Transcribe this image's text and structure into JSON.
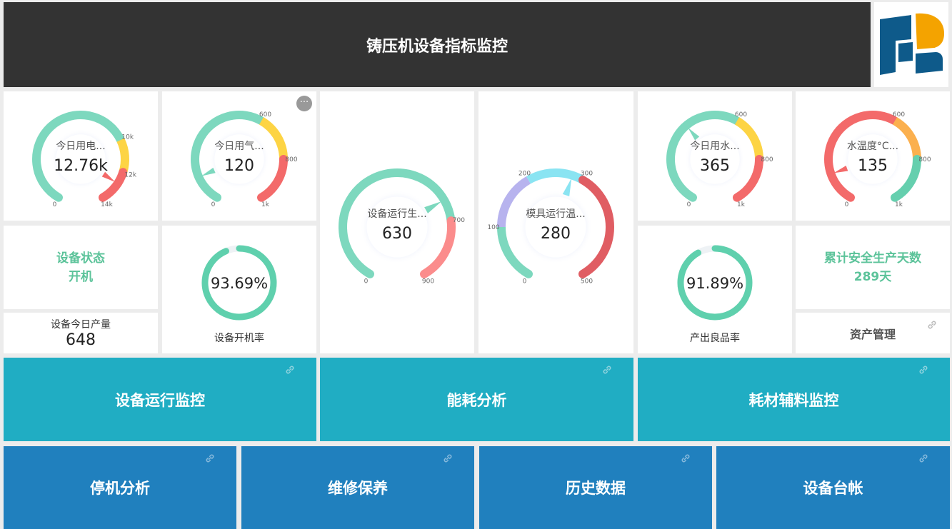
{
  "header": {
    "title": "铸压机设备指标监控"
  },
  "colors": {
    "green": "#7dd8be",
    "yellow": "#fdd444",
    "red": "#f36a6a",
    "teal": "#20adc3",
    "blue": "#2080be"
  },
  "gauges": [
    {
      "id": "electricity",
      "label": "今日用电...",
      "value": "12.76k",
      "num": 12760,
      "max": 14000,
      "ticks": [
        {
          "v": 0,
          "t": "0"
        },
        {
          "v": 10000,
          "t": "10k"
        },
        {
          "v": 12000,
          "t": "12k"
        },
        {
          "v": 14000,
          "t": "14k"
        }
      ],
      "bands": [
        {
          "to": 10000,
          "color": "#7dd8be"
        },
        {
          "to": 12000,
          "color": "#fdd444"
        },
        {
          "to": 14000,
          "color": "#f36a6a"
        }
      ]
    },
    {
      "id": "gas",
      "label": "今日用气...",
      "value": "120",
      "num": 120,
      "max": 1000,
      "ticks": [
        {
          "v": 0,
          "t": "0"
        },
        {
          "v": 600,
          "t": "600"
        },
        {
          "v": 800,
          "t": "800"
        },
        {
          "v": 1000,
          "t": "1k"
        }
      ],
      "bands": [
        {
          "to": 600,
          "color": "#7dd8be"
        },
        {
          "to": 800,
          "color": "#fdd444"
        },
        {
          "to": 1000,
          "color": "#f36a6a"
        }
      ]
    },
    {
      "id": "production",
      "label": "设备运行生...",
      "value": "630",
      "num": 630,
      "max": 900,
      "ticks": [
        {
          "v": 0,
          "t": "0"
        },
        {
          "v": 700,
          "t": "700"
        },
        {
          "v": 900,
          "t": "900"
        }
      ],
      "bands": [
        {
          "to": 700,
          "color": "#7dd8be"
        },
        {
          "to": 900,
          "color": "#fb8c8c"
        }
      ]
    },
    {
      "id": "mold-temp",
      "label": "模具运行温...",
      "value": "280",
      "num": 280,
      "max": 500,
      "ticks": [
        {
          "v": 0,
          "t": "0"
        },
        {
          "v": 100,
          "t": "100"
        },
        {
          "v": 200,
          "t": "200"
        },
        {
          "v": 300,
          "t": "300"
        },
        {
          "v": 500,
          "t": "500"
        }
      ],
      "bands": [
        {
          "to": 100,
          "color": "#7dd8be"
        },
        {
          "to": 200,
          "color": "#b7b3ee"
        },
        {
          "to": 300,
          "color": "#8ae4f2"
        },
        {
          "to": 500,
          "color": "#e05d63"
        }
      ]
    },
    {
      "id": "water",
      "label": "今日用水...",
      "value": "365",
      "num": 365,
      "max": 1000,
      "ticks": [
        {
          "v": 0,
          "t": "0"
        },
        {
          "v": 600,
          "t": "600"
        },
        {
          "v": 800,
          "t": "800"
        },
        {
          "v": 1000,
          "t": "1k"
        }
      ],
      "bands": [
        {
          "to": 600,
          "color": "#7dd8be"
        },
        {
          "to": 800,
          "color": "#fdd444"
        },
        {
          "to": 1000,
          "color": "#f36a6a"
        }
      ]
    },
    {
      "id": "water-temp",
      "label": "水温度°C...",
      "value": "135",
      "num": 135,
      "max": 1000,
      "ticks": [
        {
          "v": 0,
          "t": "0"
        },
        {
          "v": 600,
          "t": "600"
        },
        {
          "v": 800,
          "t": "800"
        },
        {
          "v": 1000,
          "t": "1k"
        }
      ],
      "bands": [
        {
          "to": 600,
          "color": "#f36a6a"
        },
        {
          "to": 800,
          "color": "#fbb04e"
        },
        {
          "to": 1000,
          "color": "#65cfae"
        }
      ]
    }
  ],
  "status": {
    "label": "设备状态",
    "value": "开机"
  },
  "output": {
    "label": "设备今日产量",
    "value": "648"
  },
  "uptime": {
    "value": "93.69%",
    "fraction": 0.9369,
    "label": "设备开机率"
  },
  "yield": {
    "value": "91.89%",
    "fraction": 0.9189,
    "label": "产出良品率"
  },
  "safety": {
    "label": "累计安全生产天数",
    "value": "289天"
  },
  "asset": {
    "label": "资产管理"
  },
  "nav_row1": [
    {
      "label": "设备运行监控"
    },
    {
      "label": "能耗分析"
    },
    {
      "label": "耗材辅料监控"
    }
  ],
  "nav_row2": [
    {
      "label": "停机分析"
    },
    {
      "label": "维修保养"
    },
    {
      "label": "历史数据"
    },
    {
      "label": "设备台帐"
    }
  ],
  "more_button": {
    "glyph": "···"
  },
  "icons": {
    "link": "link-icon",
    "more": "more-icon",
    "logo": "company-logo"
  }
}
